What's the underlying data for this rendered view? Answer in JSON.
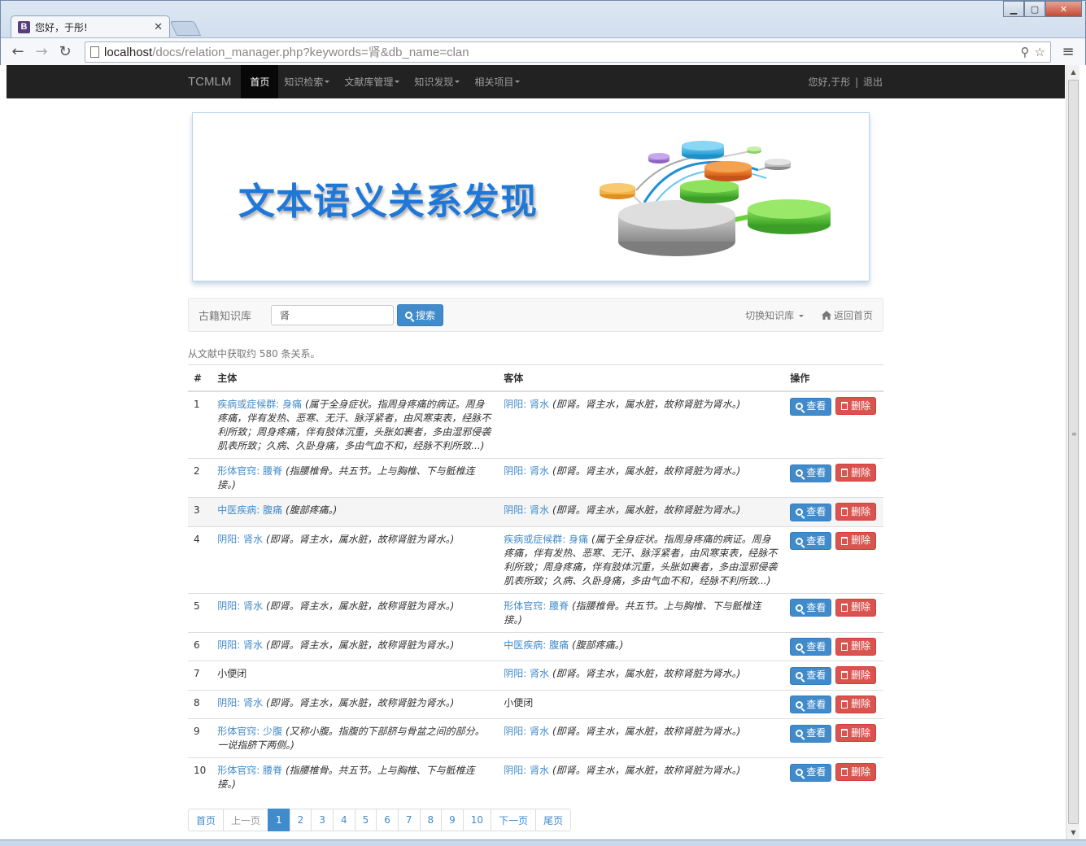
{
  "browser": {
    "tab_title": "您好，于彤!",
    "favicon_letter": "B",
    "url_host": "localhost",
    "url_path": "/docs/relation_manager.php?keywords=肾&db_name=clan"
  },
  "navbar": {
    "brand": "TCMLM",
    "items": [
      {
        "label": "首页",
        "active": true,
        "dropdown": false
      },
      {
        "label": "知识检索",
        "active": false,
        "dropdown": true
      },
      {
        "label": "文献库管理",
        "active": false,
        "dropdown": true
      },
      {
        "label": "知识发现",
        "active": false,
        "dropdown": true
      },
      {
        "label": "相关项目",
        "active": false,
        "dropdown": true
      }
    ],
    "greeting": "您好,于彤",
    "separator": "|",
    "logout": "退出"
  },
  "banner": {
    "title": "文本语义关系发现"
  },
  "search": {
    "kb_label": "古籍知识库",
    "query": "肾",
    "button": "搜索",
    "switch_kb": "切换知识库",
    "home": "返回首页"
  },
  "summary": "从文献中获取约 580 条关系。",
  "table": {
    "headers": {
      "idx": "#",
      "subject": "主体",
      "object": "客体",
      "ops": "操作"
    },
    "view_label": "查看",
    "delete_label": "删除",
    "rows": [
      {
        "idx": "1",
        "s_link": "疾病或症候群: 身痛",
        "s_desc": "(属于全身症状。指周身疼痛的病证。周身疼痛，伴有发热、恶寒、无汗、脉浮紧者，由风寒束表，经脉不利所致；周身疼痛，伴有肢体沉重，头胀如裹者，多由湿邪侵袭肌表所致；久病、久卧身痛，多由气血不和，经脉不利所致...)",
        "o_link": "阴阳: 肾水",
        "o_desc": "(即肾。肾主水，属水脏，故称肾脏为肾水。)"
      },
      {
        "idx": "2",
        "s_link": "形体官窍: 腰脊",
        "s_desc": "(指腰椎骨。共五节。上与胸椎、下与骶椎连接。)",
        "o_link": "阴阳: 肾水",
        "o_desc": "(即肾。肾主水，属水脏，故称肾脏为肾水。)"
      },
      {
        "idx": "3",
        "s_link": "中医疾病: 腹痛",
        "s_desc": "(腹部疼痛。)",
        "o_link": "阴阳: 肾水",
        "o_desc": "(即肾。肾主水，属水脏，故称肾脏为肾水。)",
        "hl": true
      },
      {
        "idx": "4",
        "s_link": "阴阳: 肾水",
        "s_desc": "(即肾。肾主水，属水脏，故称肾脏为肾水。)",
        "o_link": "疾病或症候群: 身痛",
        "o_desc": "(属于全身症状。指周身疼痛的病证。周身疼痛，伴有发热、恶寒、无汗、脉浮紧者，由风寒束表，经脉不利所致；周身疼痛，伴有肢体沉重，头胀如裹者，多由湿邪侵袭肌表所致；久病、久卧身痛，多由气血不和，经脉不利所致...)"
      },
      {
        "idx": "5",
        "s_link": "阴阳: 肾水",
        "s_desc": "(即肾。肾主水，属水脏，故称肾脏为肾水。)",
        "o_link": "形体官窍: 腰脊",
        "o_desc": "(指腰椎骨。共五节。上与胸椎、下与骶椎连接。)"
      },
      {
        "idx": "6",
        "s_link": "阴阳: 肾水",
        "s_desc": "(即肾。肾主水，属水脏，故称肾脏为肾水。)",
        "o_link": "中医疾病: 腹痛",
        "o_desc": "(腹部疼痛。)"
      },
      {
        "idx": "7",
        "s_text": "小便闭",
        "o_link": "阴阳: 肾水",
        "o_desc": "(即肾。肾主水，属水脏，故称肾脏为肾水。)"
      },
      {
        "idx": "8",
        "s_link": "阴阳: 肾水",
        "s_desc": "(即肾。肾主水，属水脏，故称肾脏为肾水。)",
        "o_text": "小便闭"
      },
      {
        "idx": "9",
        "s_link": "形体官窍: 少腹",
        "s_desc": "(又称小腹。指腹的下部脐与骨盆之间的部分。一说指脐下两侧。)",
        "o_link": "阴阳: 肾水",
        "o_desc": "(即肾。肾主水，属水脏，故称肾脏为肾水。)"
      },
      {
        "idx": "10",
        "s_link": "形体官窍: 腰脊",
        "s_desc": "(指腰椎骨。共五节。上与胸椎、下与骶椎连接。)",
        "o_link": "阴阳: 肾水",
        "o_desc": "(即肾。肾主水，属水脏，故称肾脏为肾水。)"
      }
    ]
  },
  "pagination": {
    "first": "首页",
    "prev": "上一页",
    "pages": [
      "1",
      "2",
      "3",
      "4",
      "5",
      "6",
      "7",
      "8",
      "9",
      "10"
    ],
    "current": "1",
    "next": "下一页",
    "last": "尾页"
  },
  "colors": {
    "primary": "#428bca",
    "danger": "#d9534f",
    "navbar": "#222222",
    "banner_title": "#1f78d8"
  }
}
